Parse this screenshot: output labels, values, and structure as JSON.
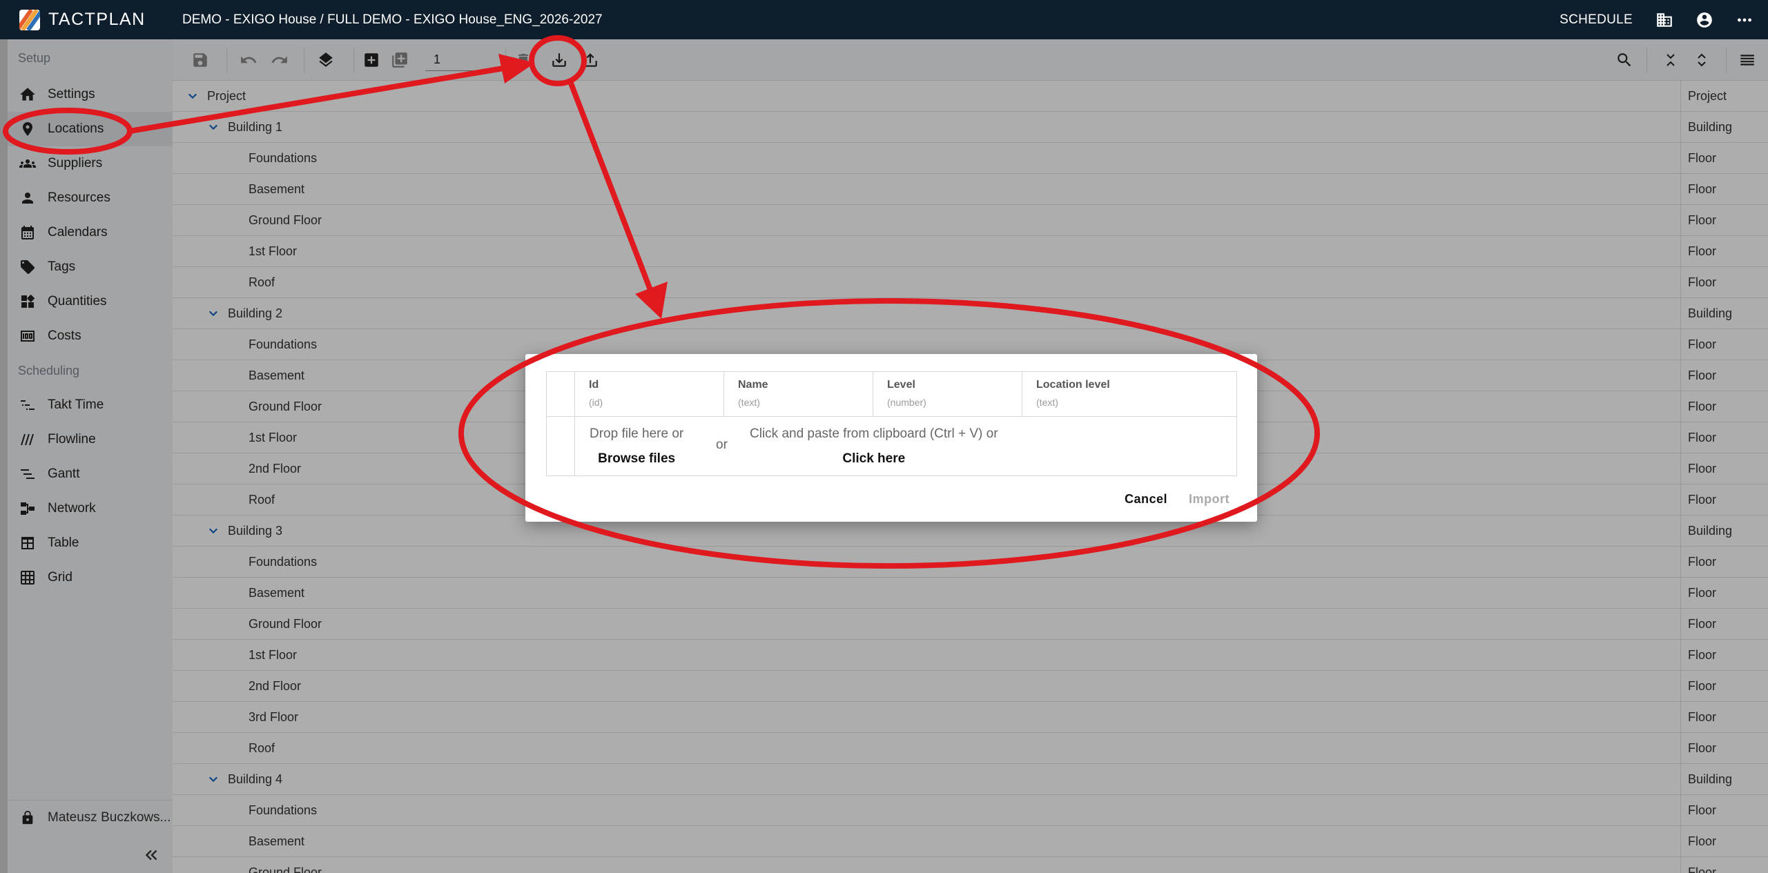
{
  "app": {
    "logo_text": "TACTPLAN",
    "breadcrumb": "DEMO - EXIGO House / FULL DEMO - EXIGO House_ENG_2026-2027",
    "schedule_label": "SCHEDULE"
  },
  "sidebar": {
    "setup_label": "Setup",
    "setup_items": [
      {
        "label": "Settings",
        "icon": "home-icon"
      },
      {
        "label": "Locations",
        "icon": "location-pin-icon"
      },
      {
        "label": "Suppliers",
        "icon": "group-icon"
      },
      {
        "label": "Resources",
        "icon": "person-icon"
      },
      {
        "label": "Calendars",
        "icon": "calendar-icon"
      },
      {
        "label": "Tags",
        "icon": "tag-icon"
      },
      {
        "label": "Quantities",
        "icon": "widgets-icon"
      },
      {
        "label": "Costs",
        "icon": "money-icon"
      }
    ],
    "scheduling_label": "Scheduling",
    "scheduling_items": [
      {
        "label": "Takt Time",
        "icon": "takt-icon"
      },
      {
        "label": "Flowline",
        "icon": "flowline-icon"
      },
      {
        "label": "Gantt",
        "icon": "gantt-icon"
      },
      {
        "label": "Network",
        "icon": "network-icon"
      },
      {
        "label": "Table",
        "icon": "table-icon"
      },
      {
        "label": "Grid",
        "icon": "grid-icon"
      }
    ],
    "user_name": "Mateusz Buczkows..."
  },
  "toolbar": {
    "quantity_value": "1"
  },
  "locations": [
    {
      "name": "Project",
      "type": "Project",
      "depth": 0,
      "expandable": true
    },
    {
      "name": "Building 1",
      "type": "Building",
      "depth": 1,
      "expandable": true
    },
    {
      "name": "Foundations",
      "type": "Floor",
      "depth": 2,
      "expandable": false
    },
    {
      "name": "Basement",
      "type": "Floor",
      "depth": 2,
      "expandable": false
    },
    {
      "name": "Ground Floor",
      "type": "Floor",
      "depth": 2,
      "expandable": false
    },
    {
      "name": "1st Floor",
      "type": "Floor",
      "depth": 2,
      "expandable": false
    },
    {
      "name": "Roof",
      "type": "Floor",
      "depth": 2,
      "expandable": false
    },
    {
      "name": "Building 2",
      "type": "Building",
      "depth": 1,
      "expandable": true
    },
    {
      "name": "Foundations",
      "type": "Floor",
      "depth": 2,
      "expandable": false
    },
    {
      "name": "Basement",
      "type": "Floor",
      "depth": 2,
      "expandable": false
    },
    {
      "name": "Ground Floor",
      "type": "Floor",
      "depth": 2,
      "expandable": false
    },
    {
      "name": "1st Floor",
      "type": "Floor",
      "depth": 2,
      "expandable": false
    },
    {
      "name": "2nd Floor",
      "type": "Floor",
      "depth": 2,
      "expandable": false
    },
    {
      "name": "Roof",
      "type": "Floor",
      "depth": 2,
      "expandable": false
    },
    {
      "name": "Building 3",
      "type": "Building",
      "depth": 1,
      "expandable": true
    },
    {
      "name": "Foundations",
      "type": "Floor",
      "depth": 2,
      "expandable": false
    },
    {
      "name": "Basement",
      "type": "Floor",
      "depth": 2,
      "expandable": false
    },
    {
      "name": "Ground Floor",
      "type": "Floor",
      "depth": 2,
      "expandable": false
    },
    {
      "name": "1st Floor",
      "type": "Floor",
      "depth": 2,
      "expandable": false
    },
    {
      "name": "2nd Floor",
      "type": "Floor",
      "depth": 2,
      "expandable": false
    },
    {
      "name": "3rd Floor",
      "type": "Floor",
      "depth": 2,
      "expandable": false
    },
    {
      "name": "Roof",
      "type": "Floor",
      "depth": 2,
      "expandable": false
    },
    {
      "name": "Building 4",
      "type": "Building",
      "depth": 1,
      "expandable": true
    },
    {
      "name": "Foundations",
      "type": "Floor",
      "depth": 2,
      "expandable": false
    },
    {
      "name": "Basement",
      "type": "Floor",
      "depth": 2,
      "expandable": false
    },
    {
      "name": "Ground Floor",
      "type": "Floor",
      "depth": 2,
      "expandable": false
    }
  ],
  "import_dialog": {
    "columns": [
      {
        "title": "Id",
        "hint": "(id)"
      },
      {
        "title": "Name",
        "hint": "(text)"
      },
      {
        "title": "Level",
        "hint": "(number)"
      },
      {
        "title": "Location level",
        "hint": "(text)"
      }
    ],
    "drop_text": "Drop file here or",
    "browse_label": "Browse files",
    "or_text": "or",
    "paste_text": "Click and paste from clipboard (Ctrl + V) or",
    "click_here_label": "Click here",
    "cancel_label": "Cancel",
    "import_label": "Import"
  },
  "colors": {
    "topbar": "#0e1e2c",
    "accent": "#1565c0",
    "annotation": "#e0191f"
  }
}
